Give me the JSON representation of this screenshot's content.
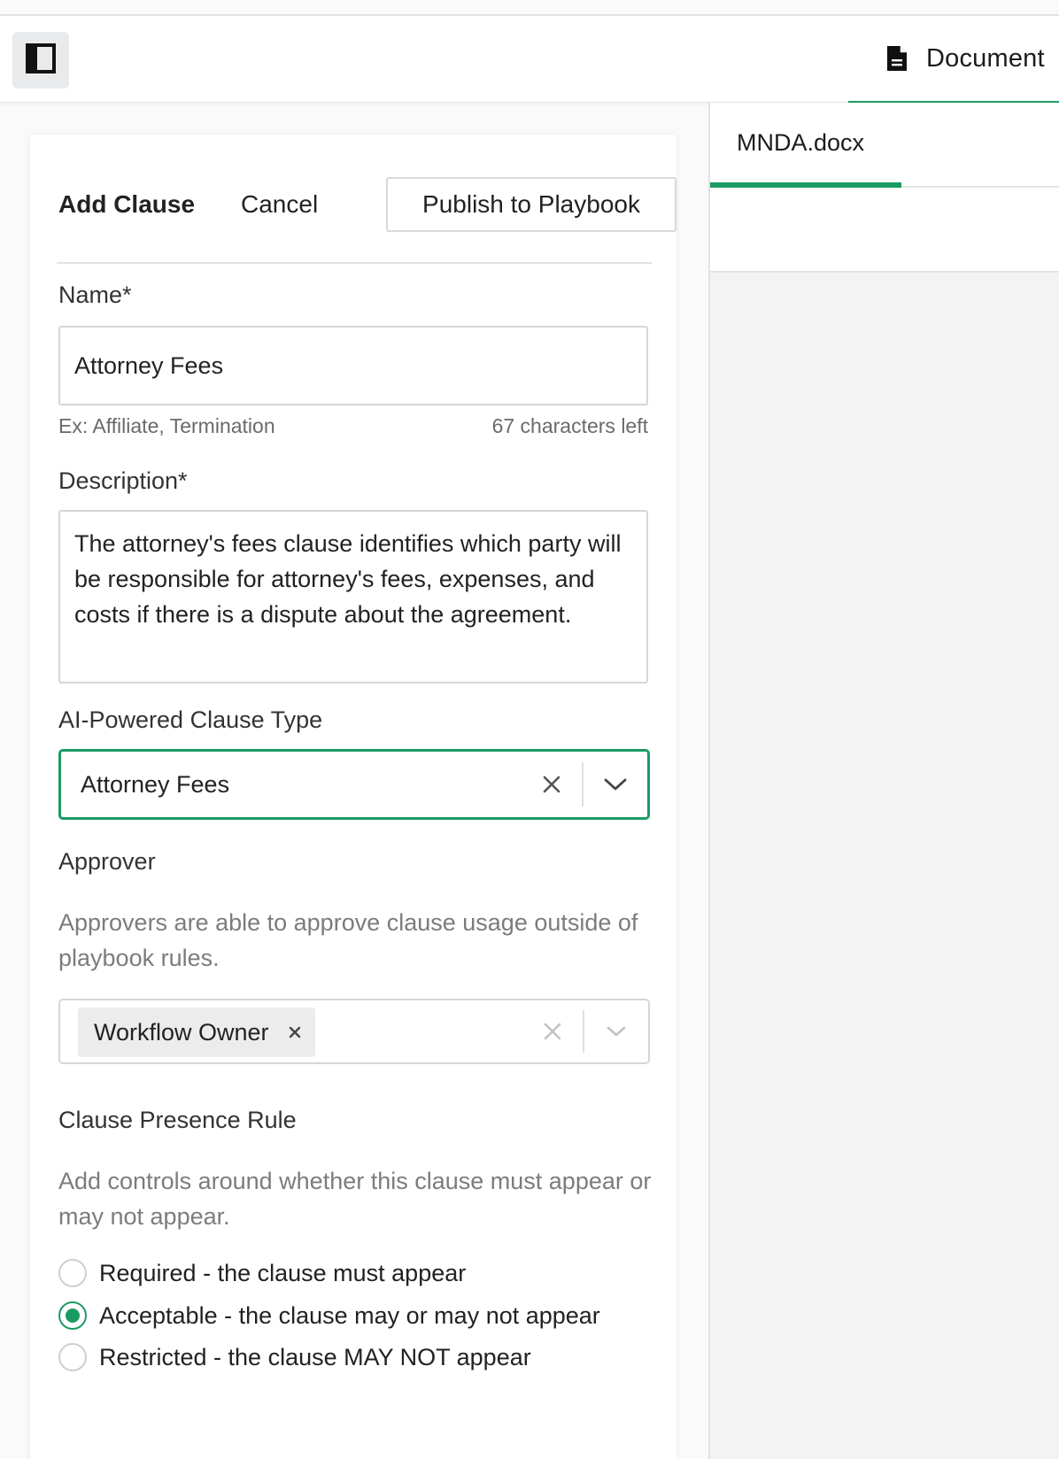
{
  "topbar": {
    "sidebar_toggle_icon": "sidebar-panel-icon",
    "tab_document": {
      "icon": "document-icon",
      "label": "Document"
    }
  },
  "form": {
    "actions": {
      "add_clause": "Add Clause",
      "cancel": "Cancel",
      "publish": "Publish to Playbook"
    },
    "name": {
      "label": "Name*",
      "value": "Attorney Fees",
      "hint": "Ex: Affiliate, Termination",
      "chars_left": "67 characters left"
    },
    "description": {
      "label": "Description*",
      "value": "The attorney's fees clause identifies which party will be responsible for attorney's fees, expenses, and costs if there is a dispute about the agreement."
    },
    "clause_type": {
      "label": "AI-Powered Clause Type",
      "value": "Attorney Fees"
    },
    "approver": {
      "label": "Approver",
      "help": "Approvers are able to approve clause usage outside of playbook rules.",
      "chips": [
        "Workflow Owner"
      ]
    },
    "presence_rule": {
      "label": "Clause Presence Rule",
      "help": "Add controls around whether this clause must appear or may not appear.",
      "options": [
        {
          "label": "Required - the clause must appear",
          "checked": false
        },
        {
          "label": "Acceptable - the clause may or may not appear",
          "checked": true
        },
        {
          "label": "Restricted - the clause MAY NOT appear",
          "checked": false
        }
      ]
    }
  },
  "document_pane": {
    "tabs": [
      "MNDA.docx"
    ]
  },
  "colors": {
    "accent": "#1a9b63",
    "border": "#d6d6d6",
    "muted_text": "#7c7c7c"
  }
}
